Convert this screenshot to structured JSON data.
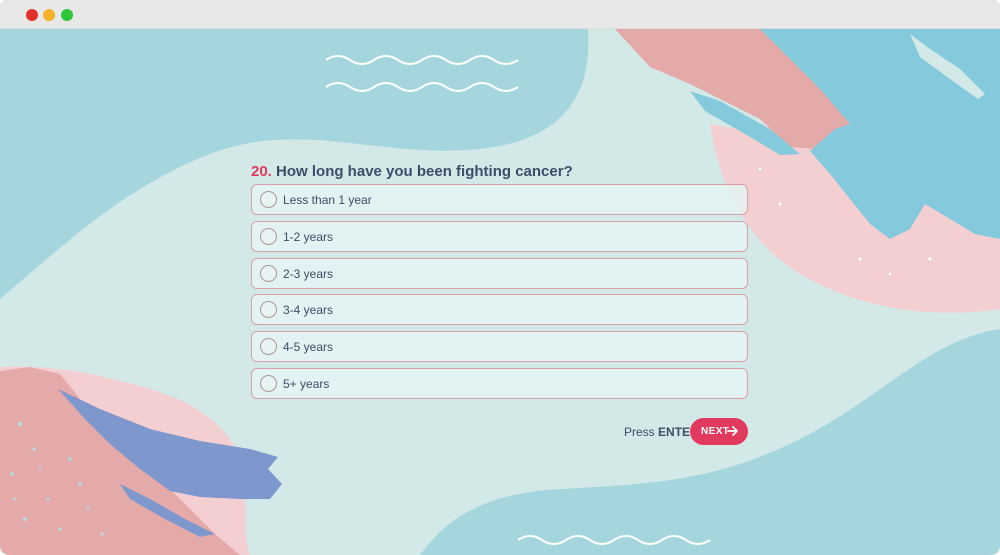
{
  "window": {
    "controls": [
      {
        "name": "close-button",
        "color": "#e3302b"
      },
      {
        "name": "minimize-button",
        "color": "#f3b12c"
      },
      {
        "name": "maximize-button",
        "color": "#2ec43c"
      }
    ]
  },
  "question": {
    "number": "20.",
    "text": "How long have you been fighting cancer?"
  },
  "options": [
    {
      "label": "Less than 1 year"
    },
    {
      "label": "1-2 years"
    },
    {
      "label": "2-3 years"
    },
    {
      "label": "3-4 years"
    },
    {
      "label": "4-5 years"
    },
    {
      "label": "5+ years"
    }
  ],
  "footer": {
    "press": "Press",
    "key": "ENTER",
    "next_label": "NEXT",
    "next_icon": "arrow-right-icon"
  },
  "colors": {
    "accent": "#e2395e",
    "text": "#3d4d68",
    "option_border": "#d8a1a6",
    "background": "#d3e9e8",
    "teal_blob": "#a5d6de",
    "pink_stroke": "#f4cfd2",
    "salmon_stroke": "#e4a9a9",
    "blue_stroke": "#85c9dc",
    "periwinkle_stroke": "#7e97cd"
  },
  "decorations": {
    "wave_icon": "wave-squiggle"
  }
}
